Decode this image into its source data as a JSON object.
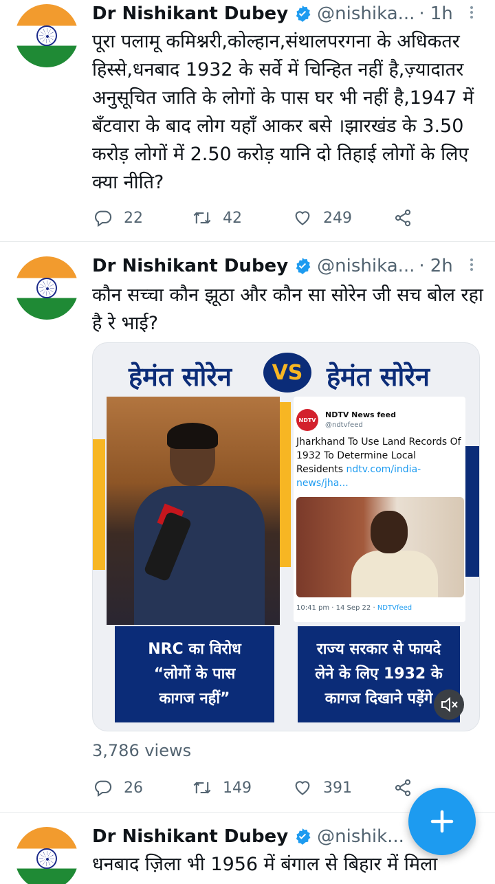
{
  "colors": {
    "accent": "#1d9bf0",
    "muted": "#536471",
    "banner_blue": "#0b2c78",
    "banner_yellow": "#f7b623"
  },
  "tweets": [
    {
      "name": "Dr Nishikant Dubey",
      "handle": "@nishika...",
      "time": "1h",
      "text": "पूरा पलामू कमिश्नरी,कोल्हान,संथालपरगना के अधिकतर हिस्से,धनबाद 1932 के सर्वे में चिन्हित नहीं है,ज़्यादातर अनुसूचित जाति के लोगों के पास घर भी नहीं है,1947 में बँटवारा के बाद लोग यहाँ आकर बसे ।झारखंड के 3.50 करोड़ लोगों में 2.50 करोड़ यानि दो तिहाई लोगों के लिए क्या नीति?",
      "replies": "22",
      "retweets": "42",
      "likes": "249"
    },
    {
      "name": "Dr Nishikant Dubey",
      "handle": "@nishika...",
      "time": "2h",
      "text": "कौन सच्चा कौन झूठा और कौन सा सोरेन जी सच बोल रहा है रे भाई?",
      "media": {
        "title_left": "हेमंत सोरेन",
        "vs": "VS",
        "title_right": "हेमंत सोरेन",
        "embedded": {
          "logo": "NDTV",
          "name": "NDTV News feed",
          "handle": "@ndtvfeed",
          "body": "Jharkhand To Use Land Records Of 1932 To Determine Local Residents ",
          "link": "ndtv.com/india-news/jha...",
          "time": "10:41 pm · 14 Sep 22 · ",
          "source": "NDTVfeed"
        },
        "caption_left": [
          "NRC का विरोध",
          "“लोगों के पास",
          "कागज नहीं”"
        ],
        "caption_right": [
          "राज्य सरकार से फायदे",
          "लेने के लिए 1932 के",
          "कागज दिखाने पड़ेंगे"
        ],
        "mute_icon": "speaker-muted-icon"
      },
      "views": "3,786 views",
      "replies": "26",
      "retweets": "149",
      "likes": "391"
    },
    {
      "name": "Dr Nishikant Dubey",
      "handle": "@nishik...",
      "text": "धनबाद ज़िला भी 1956 में बंगाल से बिहार में मिला"
    }
  ],
  "fab_icon": "compose-plus-icon"
}
